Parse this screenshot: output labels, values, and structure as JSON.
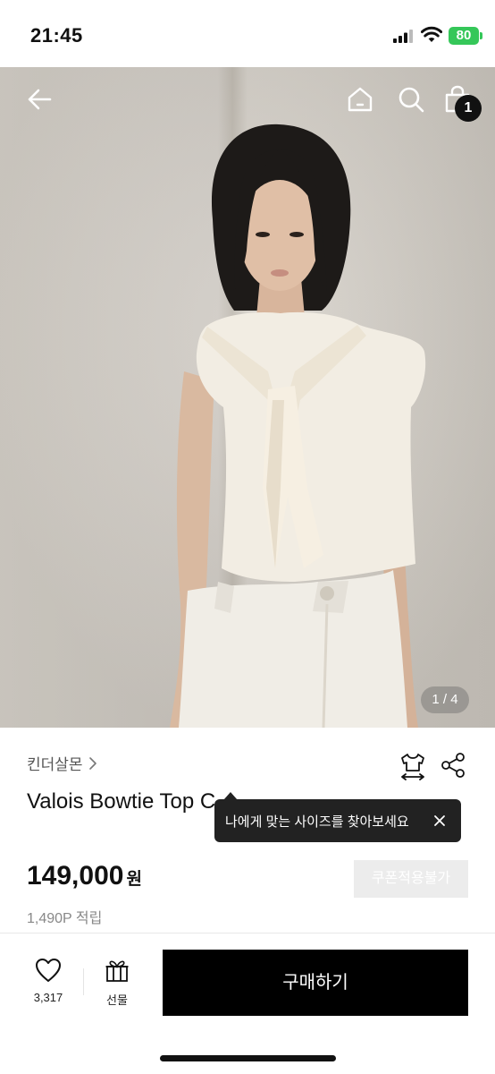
{
  "status_bar": {
    "time": "21:45",
    "battery": "80"
  },
  "nav": {
    "back_icon": "arrow-left-icon",
    "home_icon": "home-icon",
    "search_icon": "search-icon",
    "cart_icon": "shopping-bag-icon",
    "cart_count": "1"
  },
  "gallery": {
    "pager": "1 / 4"
  },
  "product": {
    "brand": "킨더살몬",
    "title": "Valois Bowtie Top C",
    "price": "149,000",
    "currency": "원",
    "coupon_label": "쿠폰적용불가",
    "points": "1,490P 적립"
  },
  "tooltip": {
    "text": "나에게 맞는 사이즈를 찾아보세요"
  },
  "bottom_bar": {
    "like_count": "3,317",
    "gift_label": "선물",
    "buy_label": "구매하기"
  },
  "colors": {
    "buy_button": "#000000",
    "coupon_bg": "#ececec",
    "battery": "#35c759"
  }
}
